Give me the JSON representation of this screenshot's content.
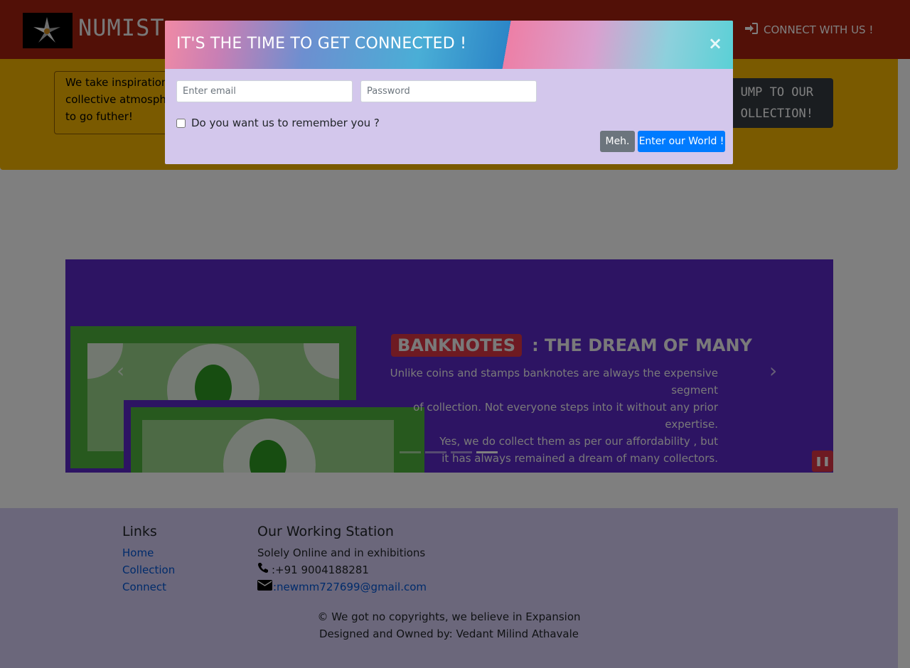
{
  "nav": {
    "brand": "NUMIST",
    "connect_label": "CONNECT WITH US !"
  },
  "jumbotron": {
    "inspire_lines": [
      "We take inspiration",
      "collective atmosphe",
      "to go futher!"
    ],
    "jump_lines": [
      "UMP TO OUR",
      "OLLECTION!"
    ]
  },
  "carousel": {
    "badge": "BANKNOTES",
    "title_rest": ": THE DREAM OF MANY",
    "text_lines": [
      "Unlike coins and stamps banknotes are always the expensive segment",
      "of collection. Not everyone steps into it without any prior expertise.",
      "Yes, we do collect them as per our affordability , but",
      "it has always remained a dream of many collectors."
    ],
    "indicator_count": 4,
    "active_indicator": 4
  },
  "footer": {
    "links_heading": "Links",
    "links": [
      "Home",
      "Collection",
      "Connect"
    ],
    "station_heading": "Our Working Station",
    "station_line": "Solely Online and in exhibitions",
    "phone": ":+91 9004188281",
    "email": ":newmm727699@gmail.com",
    "copyright": "© We got no copyrights, we believe in Expansion",
    "designer": "Designed and Owned by: Vedant Milind Athavale"
  },
  "modal": {
    "title": "IT'S THE TIME TO GET CONNECTED !",
    "close": "×",
    "email_placeholder": "Enter email",
    "password_placeholder": "Password",
    "remember_label": "Do you want us to remember you ?",
    "meh_label": "Meh.",
    "enter_label": "Enter our World !"
  },
  "colors": {
    "navbar": "#a5200f",
    "jumbotron": "#f5b500",
    "carousel": "#5b28c7",
    "footer": "#d6cff7",
    "modal_body": "#d3c7ec",
    "primary": "#007bff",
    "secondary": "#6c757d",
    "danger": "#dc3545"
  },
  "icons": [
    "compass-logo",
    "sign-in-icon",
    "chevron-left-icon",
    "chevron-right-icon",
    "pause-icon",
    "phone-icon",
    "envelope-icon"
  ]
}
